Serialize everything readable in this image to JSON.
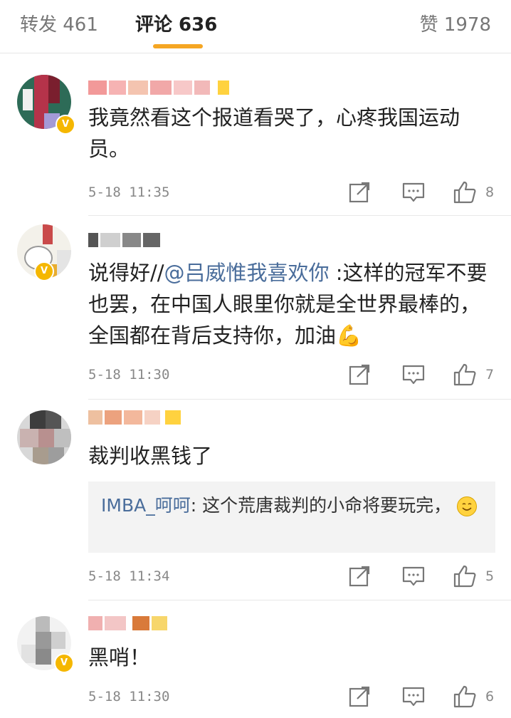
{
  "tabs": {
    "repost": "转发 461",
    "comments": "评论 636",
    "likes": "赞 1978"
  },
  "comments": [
    {
      "text": "我竟然看这个报道看哭了，心疼我国运动员。",
      "time": "5-18 11:35",
      "likes": "8"
    },
    {
      "text_prefix": "说得好//",
      "mention": "@吕威惟我喜欢你",
      "text_suffix": " :这样的冠军不要也罢，在中国人眼里你就是全世界最棒的，全国都在背后支持你，加油💪",
      "time": "5-18 11:30",
      "likes": "7"
    },
    {
      "text": "裁判收黑钱了",
      "reply_name": "IMBA_呵呵",
      "reply_text": ": 这个荒唐裁判的小命将要玩完，",
      "time": "5-18 11:34",
      "likes": "5"
    },
    {
      "text": "黑哨！",
      "time": "5-18 11:30",
      "likes": "6"
    }
  ],
  "icons": [
    "share-icon",
    "comment-icon",
    "like-icon",
    "verified-badge-icon",
    "smile-emoji-icon",
    "flex-emoji-icon"
  ],
  "colors": {
    "accent": "#f5a623",
    "link": "#4a6d9b",
    "muted": "#888888"
  }
}
